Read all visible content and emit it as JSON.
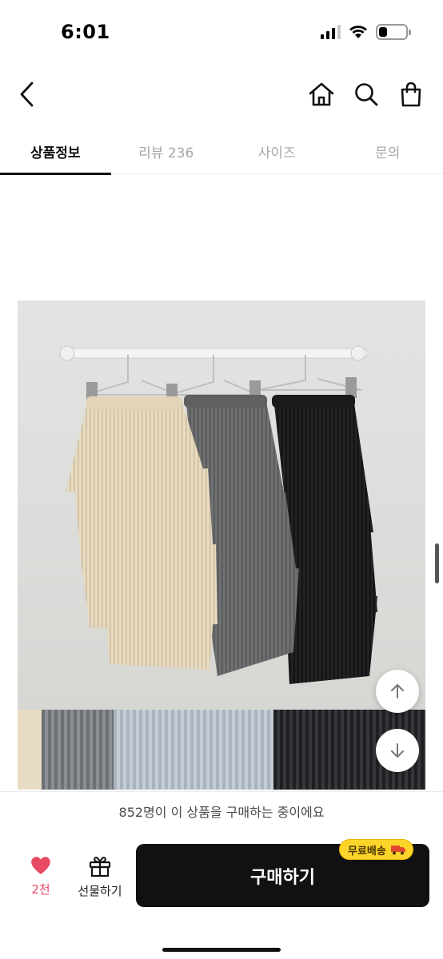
{
  "status_bar": {
    "time": "6:01",
    "battery_level": 0.3
  },
  "nav": {
    "icons": [
      "chevron-left-icon",
      "home-icon",
      "search-icon",
      "shopping-bag-icon"
    ]
  },
  "tabs": [
    {
      "label": "상품정보",
      "active": true
    },
    {
      "label": "리뷰 236",
      "active": false
    },
    {
      "label": "사이즈",
      "active": false
    },
    {
      "label": "문의",
      "active": false
    }
  ],
  "product_image": {
    "skirt_colors": [
      "#e6d8bf",
      "#6a6b6c",
      "#1c1c1e"
    ]
  },
  "floating_buttons": {
    "icons": [
      "arrow-up-icon",
      "arrow-down-icon"
    ]
  },
  "purchase_notice": "852명이 이 상품을 구매하는 중이에요",
  "bottom_bar": {
    "like_count": "2천",
    "gift_label": "선물하기",
    "buy_label": "구매하기",
    "free_shipping_badge": "무료배송"
  },
  "colors": {
    "accent_like": "#e94a63",
    "buy_button": "#111111",
    "badge": "#fcd42a"
  }
}
